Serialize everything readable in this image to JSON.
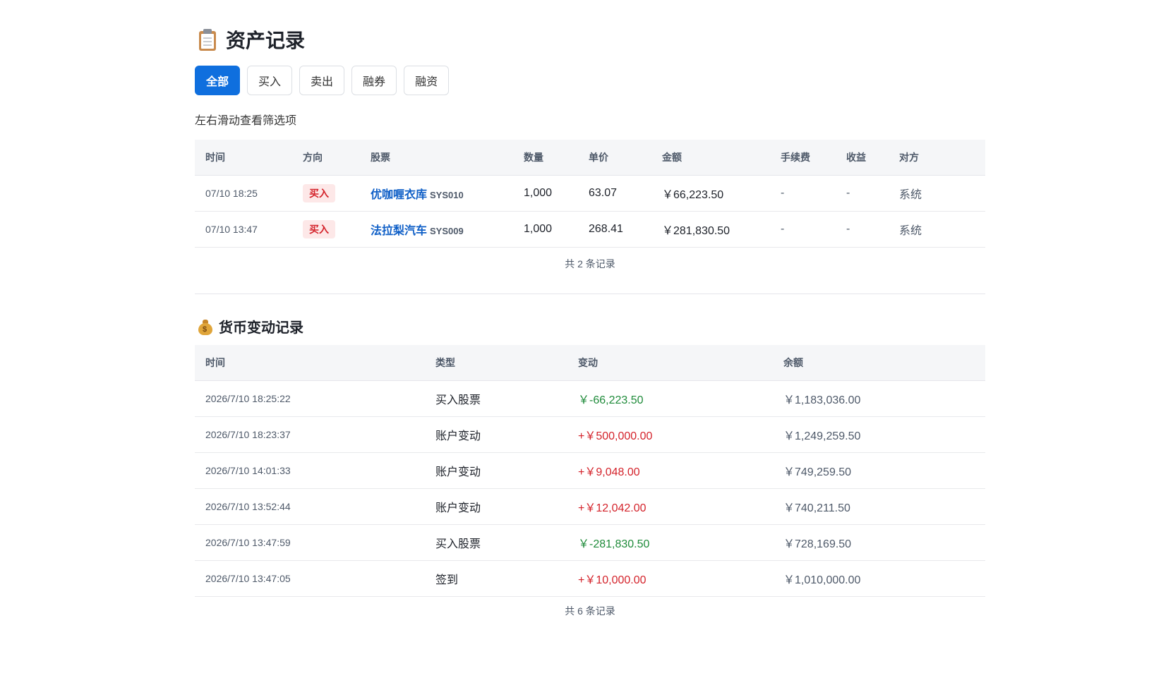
{
  "asset": {
    "title": "资产记录",
    "tabs": [
      {
        "label": "全部",
        "active": true
      },
      {
        "label": "买入",
        "active": false
      },
      {
        "label": "卖出",
        "active": false
      },
      {
        "label": "融券",
        "active": false
      },
      {
        "label": "融资",
        "active": false
      }
    ],
    "hint": "左右滑动查看筛选项",
    "columns": [
      "时间",
      "方向",
      "股票",
      "数量",
      "单价",
      "金额",
      "手续费",
      "收益",
      "对方"
    ],
    "rows": [
      {
        "time": "07/10 18:25",
        "direction": "买入",
        "stock_name": "优咖喱衣库",
        "stock_code": "SYS010",
        "qty": "1,000",
        "price": "63.07",
        "amount": "￥66,223.50",
        "fee": "-",
        "profit": "-",
        "counterparty": "系统"
      },
      {
        "time": "07/10 13:47",
        "direction": "买入",
        "stock_name": "法拉梨汽车",
        "stock_code": "SYS009",
        "qty": "1,000",
        "price": "268.41",
        "amount": "￥281,830.50",
        "fee": "-",
        "profit": "-",
        "counterparty": "系统"
      }
    ],
    "footer": "共 2 条记录"
  },
  "money": {
    "title": "货币变动记录",
    "columns": [
      "时间",
      "类型",
      "变动",
      "余额"
    ],
    "rows": [
      {
        "time": "2026/7/10 18:25:22",
        "type": "买入股票",
        "change": "￥-66,223.50",
        "sign": "neg",
        "balance": "￥1,183,036.00"
      },
      {
        "time": "2026/7/10 18:23:37",
        "type": "账户变动",
        "change": "+￥500,000.00",
        "sign": "pos",
        "balance": "￥1,249,259.50"
      },
      {
        "time": "2026/7/10 14:01:33",
        "type": "账户变动",
        "change": "+￥9,048.00",
        "sign": "pos",
        "balance": "￥749,259.50"
      },
      {
        "time": "2026/7/10 13:52:44",
        "type": "账户变动",
        "change": "+￥12,042.00",
        "sign": "pos",
        "balance": "￥740,211.50"
      },
      {
        "time": "2026/7/10 13:47:59",
        "type": "买入股票",
        "change": "￥-281,830.50",
        "sign": "neg",
        "balance": "￥728,169.50"
      },
      {
        "time": "2026/7/10 13:47:05",
        "type": "签到",
        "change": "+￥10,000.00",
        "sign": "pos",
        "balance": "￥1,010,000.00"
      }
    ],
    "footer": "共 6 条记录"
  },
  "colors": {
    "accent": "#0f6fde",
    "buy_badge_text": "#d4232b",
    "buy_badge_bg": "#fde8e8",
    "positive_change": "#d4232b",
    "negative_change": "#1f8b3a",
    "stock_link": "#0f5fc7"
  },
  "icons": {
    "asset_title_icon": "clipboard-icon",
    "money_title_icon": "money-bag-icon"
  }
}
